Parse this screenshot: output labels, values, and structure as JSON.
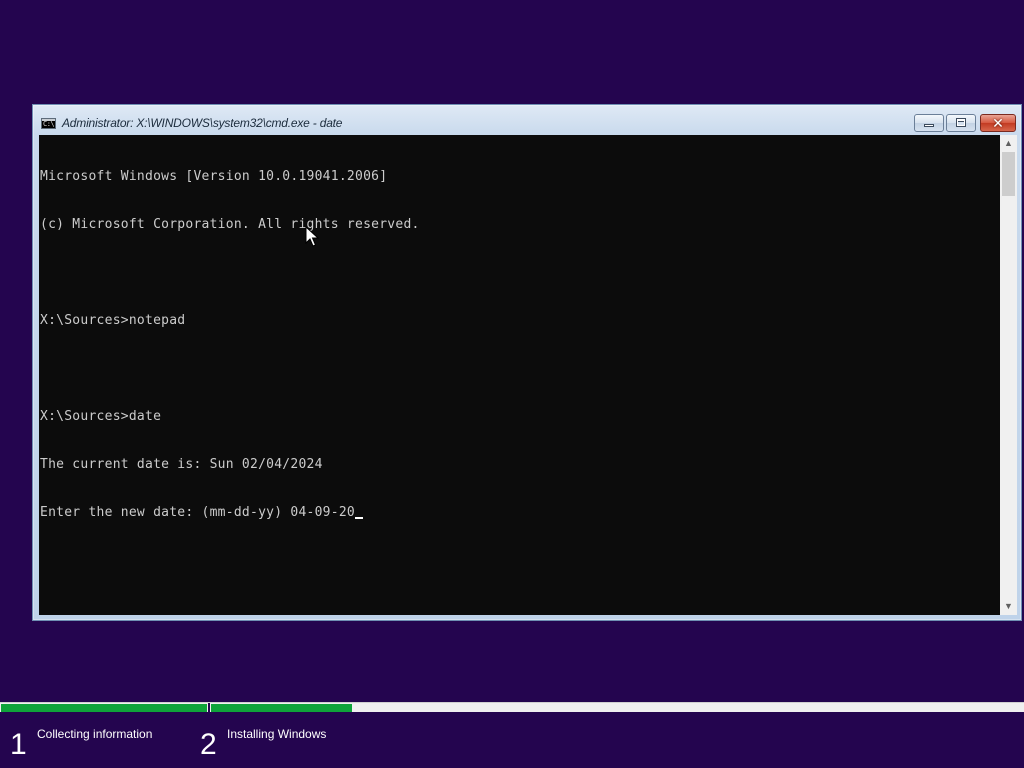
{
  "window": {
    "title": "Administrator: X:\\WINDOWS\\system32\\cmd.exe - date",
    "icon": "cmd-console-icon",
    "icon_text": "C:\\",
    "buttons": {
      "minimize_icon": "minimize-icon",
      "maximize_icon": "restore-icon",
      "close_glyph": "✕"
    }
  },
  "console": {
    "lines": [
      "Microsoft Windows [Version 10.0.19041.2006]",
      "(c) Microsoft Corporation. All rights reserved.",
      "",
      "X:\\Sources>notepad",
      "",
      "X:\\Sources>date",
      "The current date is: Sun 02/04/2024",
      "Enter the new date: (mm-dd-yy) 04-09-20"
    ],
    "background": "#0c0c0c",
    "foreground": "#cccccc"
  },
  "scrollbar": {
    "up_arrow": "▲",
    "down_arrow": "▼"
  },
  "setup": {
    "steps": [
      {
        "number": "1",
        "label": "Collecting information"
      },
      {
        "number": "2",
        "label": "Installing Windows"
      }
    ],
    "progress_color": "#0fa33a",
    "background": "#24054f"
  }
}
